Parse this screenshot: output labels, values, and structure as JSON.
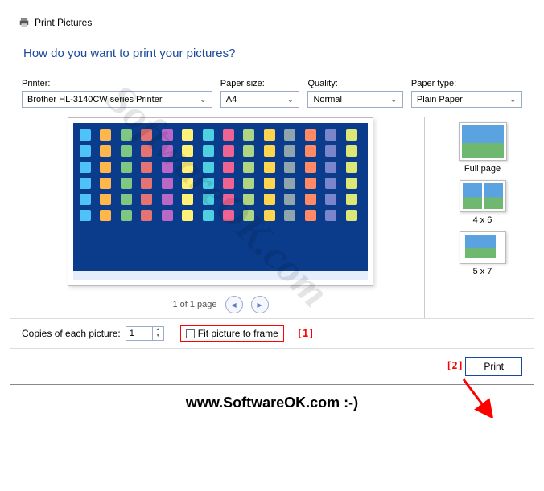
{
  "window": {
    "title": "Print Pictures"
  },
  "header": {
    "question": "How do you want to print your pictures?"
  },
  "options": {
    "printer": {
      "label": "Printer:",
      "value": "Brother HL-3140CW series Printer"
    },
    "paper_size": {
      "label": "Paper size:",
      "value": "A4"
    },
    "quality": {
      "label": "Quality:",
      "value": "Normal"
    },
    "paper_type": {
      "label": "Paper type:",
      "value": "Plain Paper"
    }
  },
  "pager": {
    "text": "1 of 1 page"
  },
  "templates": {
    "full": "Full page",
    "n4x6": "4 x 6",
    "n5x7": "5 x 7"
  },
  "bottom": {
    "copies_label": "Copies of each picture:",
    "copies_value": "1",
    "fit_label": "Fit picture to frame"
  },
  "annotations": {
    "one": "[1]",
    "two": "[2]"
  },
  "actions": {
    "print": "Print"
  },
  "watermark": "SoftwareOK.com",
  "footer": "www.SoftwareOK.com :-)"
}
